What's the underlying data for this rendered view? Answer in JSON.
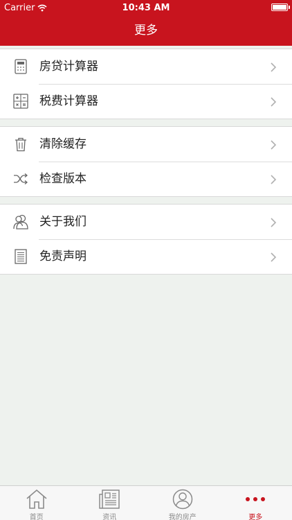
{
  "status_bar": {
    "carrier": "Carrier",
    "time": "10:43 AM",
    "battery_percent": 100
  },
  "nav": {
    "title": "更多"
  },
  "menu_groups": [
    {
      "items": [
        {
          "label": "房贷计算器",
          "icon": "calculator-icon"
        },
        {
          "label": "税费计算器",
          "icon": "tax-calculator-icon"
        }
      ]
    },
    {
      "items": [
        {
          "label": "清除缓存",
          "icon": "trash-icon"
        },
        {
          "label": "检查版本",
          "icon": "shuffle-icon"
        }
      ]
    },
    {
      "items": [
        {
          "label": "关于我们",
          "icon": "people-icon"
        },
        {
          "label": "免责声明",
          "icon": "document-icon"
        }
      ]
    }
  ],
  "tabbar": {
    "tabs": [
      {
        "label": "首页",
        "icon": "home-icon"
      },
      {
        "label": "资讯",
        "icon": "newspaper-icon"
      },
      {
        "label": "我的房产",
        "icon": "user-icon"
      },
      {
        "label": "更多",
        "icon": "more-dots-icon",
        "active": true
      }
    ]
  },
  "colors": {
    "brand": "#c8141e",
    "background": "#eef2ee",
    "inactive_tab": "#8a8a8a"
  }
}
